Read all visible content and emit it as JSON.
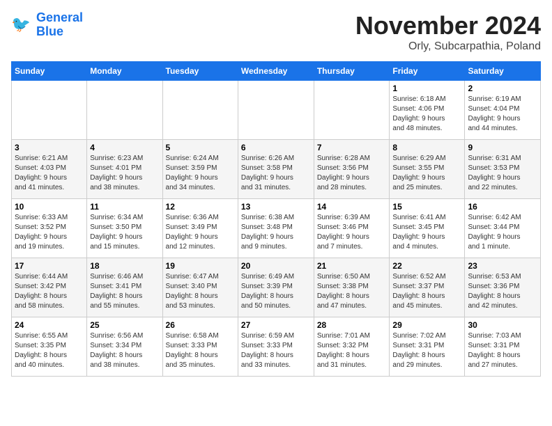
{
  "header": {
    "logo_line1": "General",
    "logo_line2": "Blue",
    "month_title": "November 2024",
    "subtitle": "Orly, Subcarpathia, Poland"
  },
  "weekdays": [
    "Sunday",
    "Monday",
    "Tuesday",
    "Wednesday",
    "Thursday",
    "Friday",
    "Saturday"
  ],
  "weeks": [
    [
      {
        "day": "",
        "info": ""
      },
      {
        "day": "",
        "info": ""
      },
      {
        "day": "",
        "info": ""
      },
      {
        "day": "",
        "info": ""
      },
      {
        "day": "",
        "info": ""
      },
      {
        "day": "1",
        "info": "Sunrise: 6:18 AM\nSunset: 4:06 PM\nDaylight: 9 hours\nand 48 minutes."
      },
      {
        "day": "2",
        "info": "Sunrise: 6:19 AM\nSunset: 4:04 PM\nDaylight: 9 hours\nand 44 minutes."
      }
    ],
    [
      {
        "day": "3",
        "info": "Sunrise: 6:21 AM\nSunset: 4:03 PM\nDaylight: 9 hours\nand 41 minutes."
      },
      {
        "day": "4",
        "info": "Sunrise: 6:23 AM\nSunset: 4:01 PM\nDaylight: 9 hours\nand 38 minutes."
      },
      {
        "day": "5",
        "info": "Sunrise: 6:24 AM\nSunset: 3:59 PM\nDaylight: 9 hours\nand 34 minutes."
      },
      {
        "day": "6",
        "info": "Sunrise: 6:26 AM\nSunset: 3:58 PM\nDaylight: 9 hours\nand 31 minutes."
      },
      {
        "day": "7",
        "info": "Sunrise: 6:28 AM\nSunset: 3:56 PM\nDaylight: 9 hours\nand 28 minutes."
      },
      {
        "day": "8",
        "info": "Sunrise: 6:29 AM\nSunset: 3:55 PM\nDaylight: 9 hours\nand 25 minutes."
      },
      {
        "day": "9",
        "info": "Sunrise: 6:31 AM\nSunset: 3:53 PM\nDaylight: 9 hours\nand 22 minutes."
      }
    ],
    [
      {
        "day": "10",
        "info": "Sunrise: 6:33 AM\nSunset: 3:52 PM\nDaylight: 9 hours\nand 19 minutes."
      },
      {
        "day": "11",
        "info": "Sunrise: 6:34 AM\nSunset: 3:50 PM\nDaylight: 9 hours\nand 15 minutes."
      },
      {
        "day": "12",
        "info": "Sunrise: 6:36 AM\nSunset: 3:49 PM\nDaylight: 9 hours\nand 12 minutes."
      },
      {
        "day": "13",
        "info": "Sunrise: 6:38 AM\nSunset: 3:48 PM\nDaylight: 9 hours\nand 9 minutes."
      },
      {
        "day": "14",
        "info": "Sunrise: 6:39 AM\nSunset: 3:46 PM\nDaylight: 9 hours\nand 7 minutes."
      },
      {
        "day": "15",
        "info": "Sunrise: 6:41 AM\nSunset: 3:45 PM\nDaylight: 9 hours\nand 4 minutes."
      },
      {
        "day": "16",
        "info": "Sunrise: 6:42 AM\nSunset: 3:44 PM\nDaylight: 9 hours\nand 1 minute."
      }
    ],
    [
      {
        "day": "17",
        "info": "Sunrise: 6:44 AM\nSunset: 3:42 PM\nDaylight: 8 hours\nand 58 minutes."
      },
      {
        "day": "18",
        "info": "Sunrise: 6:46 AM\nSunset: 3:41 PM\nDaylight: 8 hours\nand 55 minutes."
      },
      {
        "day": "19",
        "info": "Sunrise: 6:47 AM\nSunset: 3:40 PM\nDaylight: 8 hours\nand 53 minutes."
      },
      {
        "day": "20",
        "info": "Sunrise: 6:49 AM\nSunset: 3:39 PM\nDaylight: 8 hours\nand 50 minutes."
      },
      {
        "day": "21",
        "info": "Sunrise: 6:50 AM\nSunset: 3:38 PM\nDaylight: 8 hours\nand 47 minutes."
      },
      {
        "day": "22",
        "info": "Sunrise: 6:52 AM\nSunset: 3:37 PM\nDaylight: 8 hours\nand 45 minutes."
      },
      {
        "day": "23",
        "info": "Sunrise: 6:53 AM\nSunset: 3:36 PM\nDaylight: 8 hours\nand 42 minutes."
      }
    ],
    [
      {
        "day": "24",
        "info": "Sunrise: 6:55 AM\nSunset: 3:35 PM\nDaylight: 8 hours\nand 40 minutes."
      },
      {
        "day": "25",
        "info": "Sunrise: 6:56 AM\nSunset: 3:34 PM\nDaylight: 8 hours\nand 38 minutes."
      },
      {
        "day": "26",
        "info": "Sunrise: 6:58 AM\nSunset: 3:33 PM\nDaylight: 8 hours\nand 35 minutes."
      },
      {
        "day": "27",
        "info": "Sunrise: 6:59 AM\nSunset: 3:33 PM\nDaylight: 8 hours\nand 33 minutes."
      },
      {
        "day": "28",
        "info": "Sunrise: 7:01 AM\nSunset: 3:32 PM\nDaylight: 8 hours\nand 31 minutes."
      },
      {
        "day": "29",
        "info": "Sunrise: 7:02 AM\nSunset: 3:31 PM\nDaylight: 8 hours\nand 29 minutes."
      },
      {
        "day": "30",
        "info": "Sunrise: 7:03 AM\nSunset: 3:31 PM\nDaylight: 8 hours\nand 27 minutes."
      }
    ]
  ]
}
